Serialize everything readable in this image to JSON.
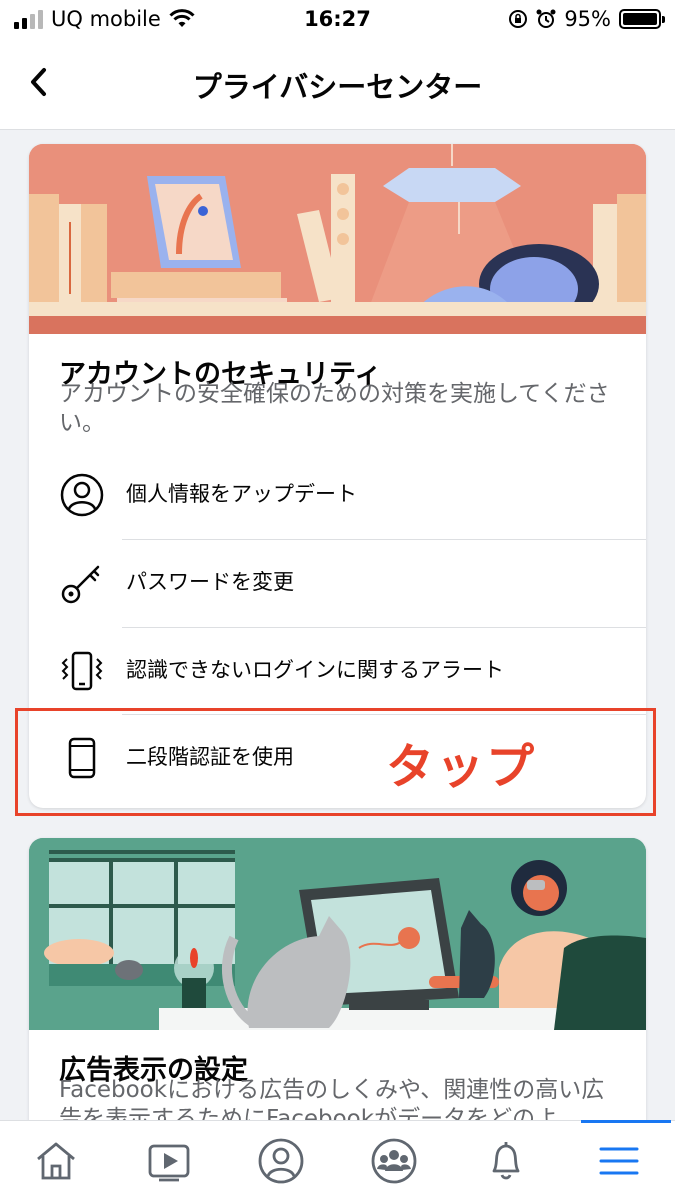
{
  "status_bar": {
    "carrier": "UQ mobile",
    "time": "16:27",
    "battery": "95%"
  },
  "nav": {
    "title": "プライバシーセンター"
  },
  "security_card": {
    "title": "アカウントのセキュリティ",
    "description": "アカウントの安全確保のための対策を実施してください。",
    "items": [
      {
        "label": "個人情報をアップデート",
        "icon": "person-circle-icon"
      },
      {
        "label": "パスワードを変更",
        "icon": "key-icon"
      },
      {
        "label": "認識できないログインに関するアラート",
        "icon": "phone-vibrate-icon"
      },
      {
        "label": "二段階認証を使用",
        "icon": "smartphone-icon"
      }
    ]
  },
  "annotation": {
    "tap_label": "タップ",
    "color": "#e8432a"
  },
  "ads_card": {
    "title": "広告表示の設定",
    "description": "Facebookにおける広告のしくみや、関連性の高い広告を表示するためにFacebookがデータをどのよ"
  },
  "tab_bar": {
    "tabs": [
      {
        "icon": "home-icon"
      },
      {
        "icon": "video-icon"
      },
      {
        "icon": "profile-icon"
      },
      {
        "icon": "groups-icon"
      },
      {
        "icon": "bell-icon"
      },
      {
        "icon": "menu-icon",
        "active": true
      }
    ]
  },
  "colors": {
    "accent": "#1877f2",
    "hero_security": "#e9907b",
    "hero_ads": "#5aa38c"
  }
}
